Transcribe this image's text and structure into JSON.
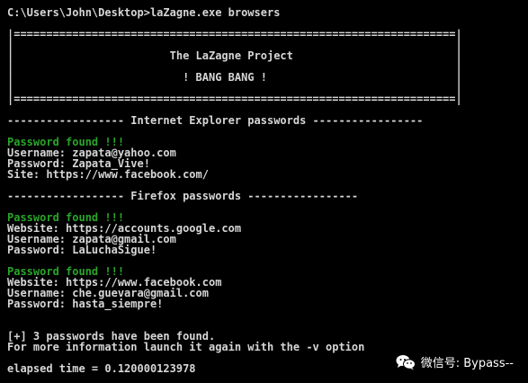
{
  "terminal": {
    "background": "#000000",
    "text_color": "#d6d6d6",
    "highlight_color": "#2aa52a",
    "lines": [
      "C:\\Users\\John\\Desktop>laZagne.exe browsers",
      "|====================================================================|",
      "|                                                                    |",
      "|                        The LaZagne Project                         |",
      "|                                                                    |",
      "|                          ! BANG BANG !                             |",
      "|                                                                    |",
      "|====================================================================|",
      "------------------ Internet Explorer passwords -----------------",
      "Password found !!!",
      "Username: zapata@yahoo.com",
      "Password: Zapata_Vive!",
      "Site: https://www.facebook.com/",
      "------------------ Firefox passwords -----------------",
      "Password found !!!",
      "Website: https://accounts.google.com",
      "Username: zapata@gmail.com",
      "Password: LaLuchaSigue!",
      "Password found !!!",
      "Website: https://www.facebook.com",
      "Username: che.guevara@gmail.com",
      "Password: hasta_siempre!",
      "[+] 3 passwords have been found.",
      "For more information launch it again with the -v option",
      "elapsed time = 0.120000123978"
    ]
  },
  "watermark": {
    "icon": "wechat-icon",
    "text": "微信号: Bypass--"
  }
}
